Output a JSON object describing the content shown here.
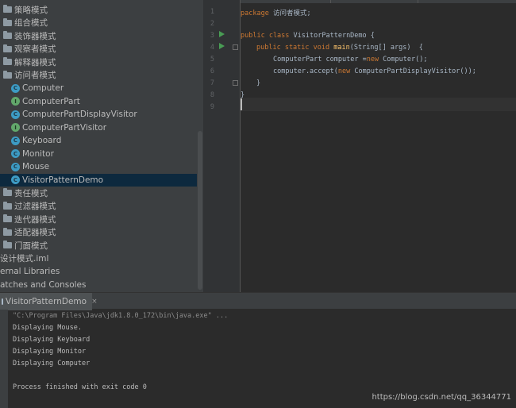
{
  "project_tree": {
    "items": [
      {
        "label": "策略模式",
        "icon": "folder-icon",
        "indent": 1
      },
      {
        "label": "组合模式",
        "icon": "folder-icon",
        "indent": 1
      },
      {
        "label": "装饰器模式",
        "icon": "folder-icon",
        "indent": 1
      },
      {
        "label": "观察者模式",
        "icon": "folder-icon",
        "indent": 1
      },
      {
        "label": "解释器模式",
        "icon": "folder-icon",
        "indent": 1
      },
      {
        "label": "访问者模式",
        "icon": "folder-icon",
        "indent": 1
      },
      {
        "label": "Computer",
        "icon": "class-icon",
        "indent": 2
      },
      {
        "label": "ComputerPart",
        "icon": "interface-icon",
        "indent": 2
      },
      {
        "label": "ComputerPartDisplayVisitor",
        "icon": "class-icon",
        "indent": 2
      },
      {
        "label": "ComputerPartVisitor",
        "icon": "interface-icon",
        "indent": 2
      },
      {
        "label": "Keyboard",
        "icon": "class-icon",
        "indent": 2
      },
      {
        "label": "Monitor",
        "icon": "class-icon",
        "indent": 2
      },
      {
        "label": "Mouse",
        "icon": "class-icon",
        "indent": 2
      },
      {
        "label": "VisitorPatternDemo",
        "icon": "class-icon",
        "indent": 2,
        "selected": true
      },
      {
        "label": "责任模式",
        "icon": "folder-icon",
        "indent": 1
      },
      {
        "label": "过滤器模式",
        "icon": "folder-icon",
        "indent": 1
      },
      {
        "label": "迭代器模式",
        "icon": "folder-icon",
        "indent": 1
      },
      {
        "label": "适配器模式",
        "icon": "folder-icon",
        "indent": 1
      },
      {
        "label": "门面模式",
        "icon": "folder-icon",
        "indent": 1
      },
      {
        "label": "设计模式.iml",
        "icon": "none",
        "indent": 0
      },
      {
        "label": "ernal Libraries",
        "icon": "none",
        "indent": 0
      },
      {
        "label": "atches and Consoles",
        "icon": "none",
        "indent": 0
      }
    ]
  },
  "editor": {
    "line_numbers": [
      "1",
      "2",
      "3",
      "4",
      "5",
      "6",
      "7",
      "8",
      "9"
    ],
    "code": {
      "l1_kw": "package",
      "l1_rest": " 访问者模式;",
      "l3_kw": "public class",
      "l3_rest": " VisitorPatternDemo {",
      "l4_kw": "public static void",
      "l4_fn": " main",
      "l4_rest": "(String[] args)  {",
      "l5_a": "ComputerPart computer =",
      "l5_kw": "new",
      "l5_b": " Computer();",
      "l6_a": "computer.accept(",
      "l6_kw": "new",
      "l6_b": " ComputerPartDisplayVisitor());",
      "l7": "}",
      "l8": "}"
    }
  },
  "run_panel": {
    "tab_label": "VisitorPatternDemo",
    "tab_close": "×",
    "console_lines": [
      "\"C:\\Program Files\\Java\\jdk1.8.0_172\\bin\\java.exe\" ...",
      "Displaying Mouse.",
      "Displaying Keyboard",
      "Displaying Monitor",
      "Displaying Computer",
      "",
      "Process finished with exit code 0"
    ]
  },
  "watermark": "https://blog.csdn.net/qq_36344771",
  "colors": {
    "keyword": "#cc7832",
    "method": "#ffc66d",
    "text": "#a9b7c6",
    "selection": "#0d293e",
    "run_icon": "#499c54"
  }
}
